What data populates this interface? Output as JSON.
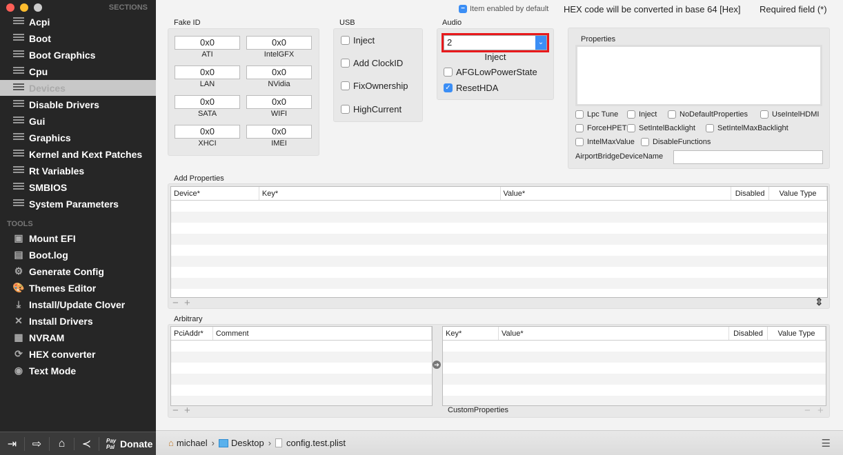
{
  "sidebar": {
    "sections_title": "SECTIONS",
    "sections": [
      "Acpi",
      "Boot",
      "Boot Graphics",
      "Cpu",
      "Devices",
      "Disable Drivers",
      "Gui",
      "Graphics",
      "Kernel and Kext Patches",
      "Rt Variables",
      "SMBIOS",
      "System Parameters"
    ],
    "selected": "Devices",
    "tools_title": "TOOLS",
    "tools": [
      {
        "label": "Mount EFI",
        "icon": "disk-icon",
        "glyph": "▣"
      },
      {
        "label": "Boot.log",
        "icon": "laptop-icon",
        "glyph": "▤"
      },
      {
        "label": "Generate Config",
        "icon": "gears-icon",
        "glyph": "⚙"
      },
      {
        "label": "Themes Editor",
        "icon": "palette-icon",
        "glyph": "🎨"
      },
      {
        "label": "Install/Update Clover",
        "icon": "download-icon",
        "glyph": "⤓"
      },
      {
        "label": "Install Drivers",
        "icon": "tools-icon",
        "glyph": "✕"
      },
      {
        "label": "NVRAM",
        "icon": "chip-icon",
        "glyph": "▦"
      },
      {
        "label": "HEX converter",
        "icon": "refresh-icon",
        "glyph": "⟳"
      },
      {
        "label": "Text Mode",
        "icon": "eye-icon",
        "glyph": "◉"
      }
    ],
    "donate_label": "Donate",
    "paypal": "Pay Pal"
  },
  "header": {
    "item_enabled": "Item enabled by default",
    "hex_note": "HEX code will be converted in base 64 [Hex]",
    "required": "Required field (*)"
  },
  "fake_id": {
    "title": "Fake ID",
    "fields": [
      {
        "label": "ATI",
        "value": "0x0"
      },
      {
        "label": "IntelGFX",
        "value": "0x0"
      },
      {
        "label": "LAN",
        "value": "0x0"
      },
      {
        "label": "NVidia",
        "value": "0x0"
      },
      {
        "label": "SATA",
        "value": "0x0"
      },
      {
        "label": "WIFI",
        "value": "0x0"
      },
      {
        "label": "XHCI",
        "value": "0x0"
      },
      {
        "label": "IMEI",
        "value": "0x0"
      }
    ]
  },
  "usb": {
    "title": "USB",
    "options": [
      {
        "label": "Inject",
        "checked": false
      },
      {
        "label": "Add ClockID",
        "checked": false
      },
      {
        "label": "FixOwnership",
        "checked": false
      },
      {
        "label": "HighCurrent",
        "checked": false
      }
    ]
  },
  "audio": {
    "title": "Audio",
    "inject_value": "2",
    "inject_label": "Inject",
    "options": [
      {
        "label": "AFGLowPowerState",
        "checked": false
      },
      {
        "label": "ResetHDA",
        "checked": true
      }
    ]
  },
  "properties": {
    "title": "Properties",
    "text": "",
    "options": [
      {
        "label": "Lpc Tune",
        "checked": false
      },
      {
        "label": "Inject",
        "checked": false
      },
      {
        "label": "NoDefaultProperties",
        "checked": false
      },
      {
        "label": "UseIntelHDMI",
        "checked": false
      },
      {
        "label": "ForceHPET",
        "checked": false
      },
      {
        "label": "SetIntelBacklight",
        "checked": false
      },
      {
        "label": "SetIntelMaxBacklight",
        "checked": false
      },
      {
        "label": "IntelMaxValue",
        "checked": false
      },
      {
        "label": "DisableFunctions",
        "checked": false
      }
    ],
    "airport_label": "AirportBridgeDeviceName",
    "airport_value": ""
  },
  "add_properties": {
    "title": "Add Properties",
    "columns": [
      "Device*",
      "Key*",
      "Value*",
      "Disabled",
      "Value Type"
    ]
  },
  "arbitrary": {
    "title": "Arbitrary",
    "left_columns": [
      "PciAddr*",
      "Comment"
    ],
    "right_columns": [
      "Key*",
      "Value*",
      "Disabled",
      "Value Type"
    ],
    "custom_label": "CustomProperties"
  },
  "pathbar": {
    "items": [
      "michael",
      "Desktop",
      "config.test.plist"
    ]
  }
}
